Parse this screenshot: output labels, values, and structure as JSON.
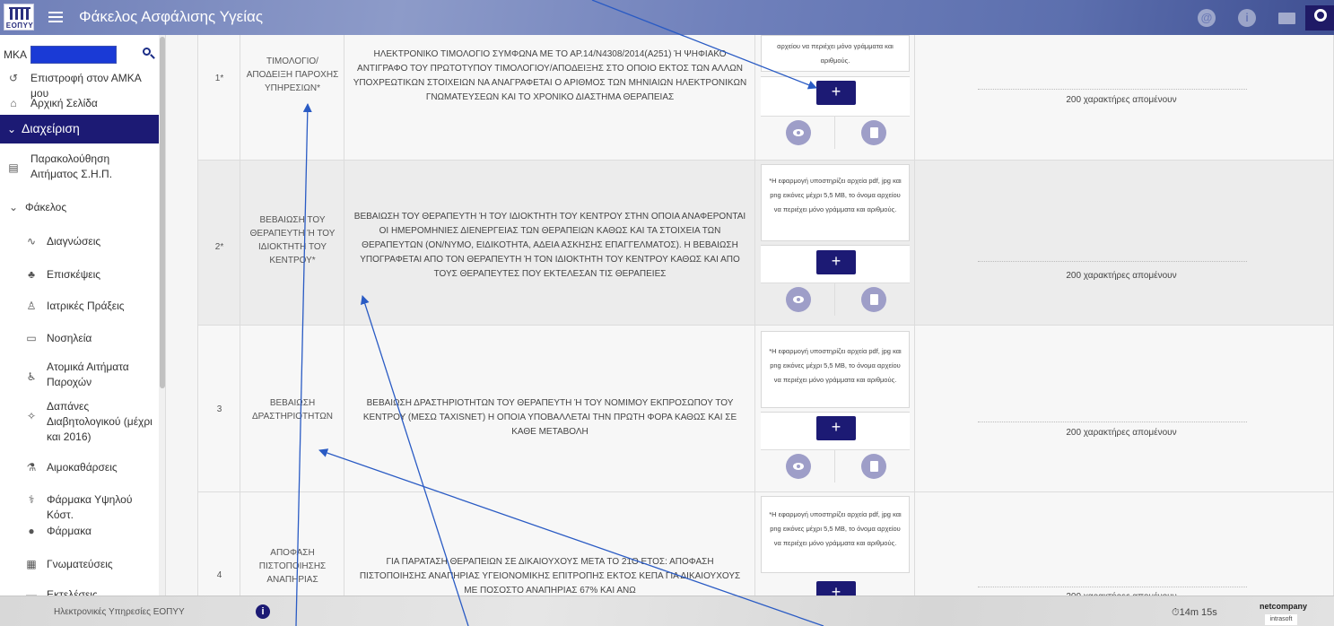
{
  "header": {
    "logo_text": "ΕΟΠΥΥ",
    "title": "Φάκελος Ασφάλισης Υγείας",
    "at_icon": "at-icon",
    "info_icon": "info-icon"
  },
  "sidebar": {
    "search_label": "ΜΚΑ",
    "search_value": "",
    "items": [
      {
        "label": "Επιστροφή στον ΑΜΚΑ μου",
        "icon": "history-icon"
      },
      {
        "label": "Αρχική Σελίδα",
        "icon": "home-icon"
      },
      {
        "label": "Διαχείριση",
        "icon": "chevron-down-icon"
      },
      {
        "label": "Παρακολούθηση Αιτήματος Σ.Η.Π.",
        "icon": "document-icon"
      },
      {
        "label": "Φάκελος",
        "icon": "chevron-down-icon"
      },
      {
        "label": "Διαγνώσεις",
        "icon": "pulse-icon"
      },
      {
        "label": "Επισκέψεις",
        "icon": "visit-icon"
      },
      {
        "label": "Ιατρικές Πράξεις",
        "icon": "doctor-icon"
      },
      {
        "label": "Νοσηλεία",
        "icon": "bed-icon"
      },
      {
        "label": "Ατομικά Αιτήματα Παροχών",
        "icon": "wheelchair-icon"
      },
      {
        "label": "Δαπάνες Διαβητολογικού (μέχρι και 2016)",
        "icon": "diabetes-icon"
      },
      {
        "label": "Αιμοκαθάρσεις",
        "icon": "dialysis-icon"
      },
      {
        "label": "Φάρμακα Υψηλού Κόστ.",
        "icon": "pill-icon"
      },
      {
        "label": "Φάρμακα",
        "icon": "pills-icon"
      },
      {
        "label": "Γνωματεύσεις",
        "icon": "report-icon"
      },
      {
        "label": "Εκτελέσεις",
        "icon": "list-icon"
      }
    ]
  },
  "table": {
    "file_hint": "*Η εφαρμογή υποστηρίζει αρχεία pdf, jpg και png εικόνες μέχρι 5,5 MB, το όνομα αρχείου να περιέχει μόνο γράμματα και αριθμούς.",
    "row1_hint_partial": "αρχείου να περιέχει μόνο γράμματα και αριθμούς.",
    "add_label": "+",
    "remaining_chars": "200 χαρακτήρες απομένουν",
    "rows": [
      {
        "num": "1*",
        "name": "ΤΙΜΟΛΟΓΙΟ/ ΑΠΟΔΕΙΞΗ ΠΑΡΟΧΗΣ ΥΠΗΡΕΣΙΩΝ*",
        "desc": "ΗΛΕΚΤΡΟΝΙΚΟ ΤΙΜΟΛΟΓΙΟ ΣΥΜΦΩΝΑ ΜΕ ΤΟ ΑΡ.14/Ν4308/2014(Α251) Ή ΨΗΦΙΑΚΟ ΑΝΤΙΓΡΑΦΟ ΤΟΥ ΠΡΩΤΟΤΥΠΟΥ ΤΙΜΟΛΟΓΙΟΥ/ΑΠΟΔΕΙΞΗΣ ΣΤΟ ΟΠΟΙΟ ΕΚΤΟΣ ΤΩΝ ΑΛΛΩΝ ΥΠΟΧΡΕΩΤΙΚΩΝ ΣΤΟΙΧΕΙΩΝ ΝΑ ΑΝΑΓΡΑΦΕΤΑΙ Ο ΑΡΙΘΜΟΣ ΤΩΝ ΜΗΝΙΑΙΩΝ ΗΛΕΚΤΡΟΝΙΚΩΝ ΓΝΩΜΑΤΕΥΣΕΩΝ ΚΑΙ ΤΟ ΧΡΟΝΙΚΟ ΔΙΑΣΤΗΜΑ ΘΕΡΑΠΕΙΑΣ"
      },
      {
        "num": "2*",
        "name": "ΒΕΒΑΙΩΣΗ ΤΟΥ ΘΕΡΑΠΕΥΤΗ Ή ΤΟΥ ΙΔΙΟΚΤΗΤΗ ΤΟΥ ΚΕΝΤΡΟΥ*",
        "desc": "ΒΕΒΑΙΩΣΗ ΤΟΥ ΘΕΡΑΠΕΥΤΗ Ή ΤΟΥ ΙΔΙΟΚΤΗΤΗ ΤΟΥ ΚΕΝΤΡΟΥ ΣΤΗΝ ΟΠΟΙΑ ΑΝΑΦΕΡΟΝΤΑΙ ΟΙ ΗΜΕΡΟΜΗΝΙΕΣ ΔΙΕΝΕΡΓΕΙΑΣ ΤΩΝ ΘΕΡΑΠΕΙΩΝ ΚΑΘΩΣ ΚΑΙ ΤΑ ΣΤΟΙΧΕΙΑ ΤΩΝ ΘΕΡΑΠΕΥΤΩΝ (ΟΝ/ΝΥΜΟ, ΕΙΔΙΚΟΤΗΤΑ, ΑΔΕΙΑ ΑΣΚΗΣΗΣ ΕΠΑΓΓΕΛΜΑΤΟΣ). Η ΒΕΒΑΙΩΣΗ ΥΠΟΓΡΑΦΕΤΑΙ ΑΠΟ ΤΟΝ ΘΕΡΑΠΕΥΤΗ Ή ΤΟΝ ΙΔΙΟΚΤΗΤΗ ΤΟΥ ΚΕΝΤΡΟΥ ΚΑΘΩΣ ΚΑΙ ΑΠΟ ΤΟΥΣ ΘΕΡΑΠΕΥΤΕΣ ΠΟΥ ΕΚΤΕΛΕΣΑΝ ΤΙΣ ΘΕΡΑΠΕΙΕΣ"
      },
      {
        "num": "3",
        "name": "ΒΕΒΑΙΩΣΗ ΔΡΑΣΤΗΡΙΟΤΗΤΩΝ",
        "desc": "ΒΕΒΑΙΩΣΗ ΔΡΑΣΤΗΡΙΟΤΗΤΩΝ ΤΟΥ ΘΕΡΑΠΕΥΤΗ Ή ΤΟΥ ΝΟΜΙΜΟΥ ΕΚΠΡΟΣΩΠΟΥ ΤΟΥ ΚΕΝΤΡΟΥ (ΜΕΣΩ TAXISNET) Η ΟΠΟΙΑ ΥΠΟΒΑΛΛΕΤΑΙ ΤΗΝ ΠΡΩΤΗ ΦΟΡΑ ΚΑΘΩΣ ΚΑΙ ΣΕ ΚΑΘΕ ΜΕΤΑΒΟΛΗ"
      },
      {
        "num": "4",
        "name": "ΑΠΟΦΑΣΗ ΠΙΣΤΟΠΟΙΗΣΗΣ ΑΝΑΠΗΡΙΑΣ",
        "desc": "ΓΙΑ ΠΑΡΑΤΑΣΗ ΘΕΡΑΠΕΙΩΝ ΣΕ ΔΙΚΑΙΟΥΧΟΥΣ ΜΕΤΑ ΤΟ 21Ο ΕΤΟΣ: ΑΠΟΦΑΣΗ ΠΙΣΤΟΠΟΙΗΣΗΣ ΑΝΑΠΗΡΙΑΣ ΥΓΕΙΟΝΟΜΙΚΗΣ ΕΠΙΤΡΟΠΗΣ ΕΚΤΟΣ ΚΕΠΑ ΓΙΑ ΔΙΚΑΙΟΥΧΟΥΣ ΜΕ ΠΟΣΟΣΤΟ ΑΝΑΠΗΡΙΑΣ 67% ΚΑΙ ΑΝΩ"
      }
    ]
  },
  "footer": {
    "text": "Ηλεκτρονικές Υπηρεσίες ΕΟΠΥΥ",
    "timer": "14m 15s",
    "brand_top": "netcompany",
    "brand_bottom": "intrasoft"
  },
  "colors": {
    "brand_dark": "#1c1a74",
    "header_blue": "#6f7fb8",
    "annotation_arrow": "#2a5bc4"
  }
}
